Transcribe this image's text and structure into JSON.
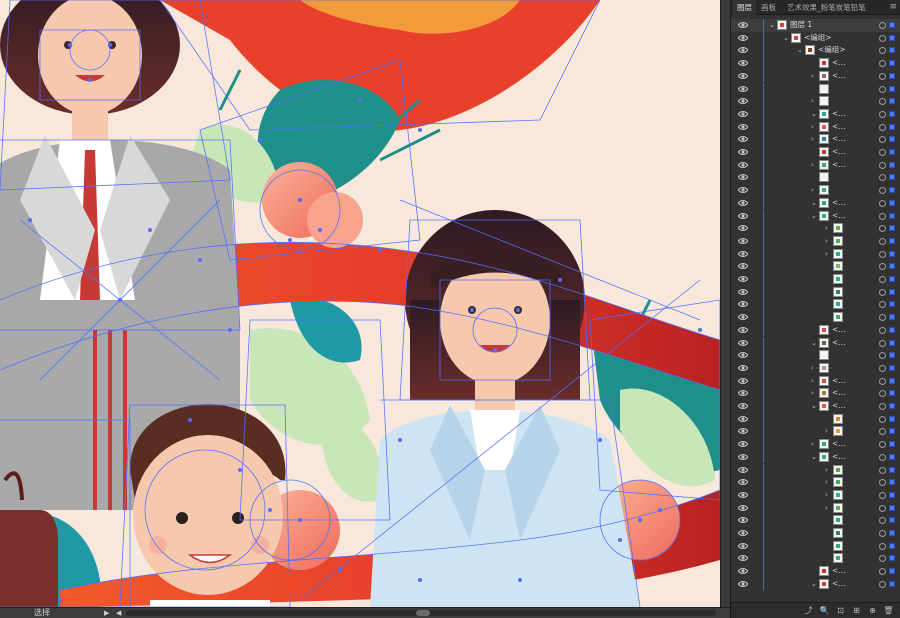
{
  "panel": {
    "tabs": [
      {
        "label": "图层",
        "active": true
      },
      {
        "label": "画板",
        "active": false
      },
      {
        "label": "艺术效果_粉笔炭笔铅笔",
        "active": false
      }
    ],
    "rows": [
      {
        "indent": 0,
        "expanded": true,
        "label": "图层 1",
        "thumb": "#c44"
      },
      {
        "indent": 1,
        "expanded": true,
        "label": "<编组>",
        "thumb": "#c44"
      },
      {
        "indent": 2,
        "expanded": true,
        "label": "<编组>",
        "thumb": "#743"
      },
      {
        "indent": 3,
        "expanded": null,
        "label": "<...",
        "thumb": "#d33"
      },
      {
        "indent": 3,
        "expanded": false,
        "label": "<...",
        "thumb": "#966"
      },
      {
        "indent": 3,
        "expanded": null,
        "label": "",
        "thumb": ""
      },
      {
        "indent": 3,
        "expanded": false,
        "label": "",
        "thumb": ""
      },
      {
        "indent": 3,
        "expanded": true,
        "label": "<...",
        "thumb": "#2a8"
      },
      {
        "indent": 3,
        "expanded": false,
        "label": "<...",
        "thumb": "#d55"
      },
      {
        "indent": 3,
        "expanded": false,
        "label": "<...",
        "thumb": "#289"
      },
      {
        "indent": 3,
        "expanded": null,
        "label": "<...",
        "thumb": "#c33"
      },
      {
        "indent": 3,
        "expanded": false,
        "label": "<...",
        "thumb": "#3a6"
      },
      {
        "indent": 3,
        "expanded": null,
        "label": "",
        "thumb": ""
      },
      {
        "indent": 3,
        "expanded": false,
        "label": "",
        "thumb": "#4a8"
      },
      {
        "indent": 3,
        "expanded": true,
        "label": "<...",
        "thumb": "#2a7"
      },
      {
        "indent": 3,
        "expanded": true,
        "label": "<...",
        "thumb": "#3a9"
      },
      {
        "indent": 4,
        "expanded": false,
        "label": "",
        "thumb": "#6a4"
      },
      {
        "indent": 4,
        "expanded": false,
        "label": "",
        "thumb": "#5a5"
      },
      {
        "indent": 4,
        "expanded": false,
        "label": "",
        "thumb": "#3a8"
      },
      {
        "indent": 4,
        "expanded": null,
        "label": "",
        "thumb": "#7b5"
      },
      {
        "indent": 4,
        "expanded": null,
        "label": "",
        "thumb": "#2a9"
      },
      {
        "indent": 4,
        "expanded": null,
        "label": "",
        "thumb": "#286"
      },
      {
        "indent": 4,
        "expanded": null,
        "label": "",
        "thumb": "#3a7"
      },
      {
        "indent": 4,
        "expanded": null,
        "label": "",
        "thumb": "#4a6"
      },
      {
        "indent": 3,
        "expanded": null,
        "label": "<...",
        "thumb": "#d44"
      },
      {
        "indent": 3,
        "expanded": true,
        "label": "<...",
        "thumb": "#853"
      },
      {
        "indent": 3,
        "expanded": null,
        "label": "",
        "thumb": ""
      },
      {
        "indent": 3,
        "expanded": false,
        "label": "",
        "thumb": "#999"
      },
      {
        "indent": 3,
        "expanded": false,
        "label": "<...",
        "thumb": "#c53"
      },
      {
        "indent": 3,
        "expanded": false,
        "label": "<...",
        "thumb": "#a74"
      },
      {
        "indent": 3,
        "expanded": true,
        "label": "<...",
        "thumb": "#c63"
      },
      {
        "indent": 4,
        "expanded": null,
        "label": "",
        "thumb": "#d82"
      },
      {
        "indent": 4,
        "expanded": false,
        "label": "",
        "thumb": "#e93"
      },
      {
        "indent": 3,
        "expanded": false,
        "label": "<...",
        "thumb": "#2a8"
      },
      {
        "indent": 3,
        "expanded": true,
        "label": "<...",
        "thumb": "#3a7"
      },
      {
        "indent": 4,
        "expanded": false,
        "label": "",
        "thumb": "#5a4"
      },
      {
        "indent": 4,
        "expanded": false,
        "label": "",
        "thumb": "#4a6"
      },
      {
        "indent": 4,
        "expanded": false,
        "label": "",
        "thumb": "#3a8"
      },
      {
        "indent": 4,
        "expanded": false,
        "label": "",
        "thumb": "#6a5"
      },
      {
        "indent": 4,
        "expanded": null,
        "label": "",
        "thumb": "#2a9"
      },
      {
        "indent": 4,
        "expanded": null,
        "label": "",
        "thumb": "#286"
      },
      {
        "indent": 4,
        "expanded": null,
        "label": "",
        "thumb": "#3a7"
      },
      {
        "indent": 4,
        "expanded": null,
        "label": "",
        "thumb": "#4a6"
      },
      {
        "indent": 3,
        "expanded": null,
        "label": "<...",
        "thumb": "#c33"
      },
      {
        "indent": 3,
        "expanded": true,
        "label": "<...",
        "thumb": "#b44"
      }
    ]
  },
  "status": {
    "tool_name": "选择",
    "arrow": "▶",
    "left_arrow": "◀"
  },
  "footer": {
    "buttons": [
      "⤴",
      "🔍",
      "⊡",
      "⊞",
      "⊕",
      "🗑"
    ]
  },
  "colors": {
    "background": "#f7e6da",
    "ribbon": "#e8402a",
    "ribbon_dark": "#c8281c",
    "teal": "#1f8f9a",
    "mint": "#bfe3b5",
    "selection": "#4f6fff",
    "hair": "#3a1f22",
    "skin": "#f6c8ae"
  }
}
